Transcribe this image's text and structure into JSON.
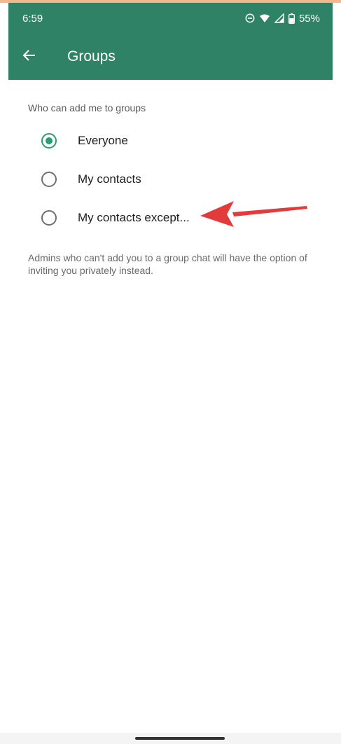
{
  "status_bar": {
    "time": "6:59",
    "battery": "55%",
    "icons": [
      "do-not-disturb-icon",
      "wifi-icon",
      "signal-icon",
      "battery-icon"
    ]
  },
  "app_bar": {
    "title": "Groups",
    "back_icon": "back-arrow-icon"
  },
  "settings": {
    "section_label": "Who can add me to groups",
    "options": [
      {
        "label": "Everyone",
        "selected": true
      },
      {
        "label": "My contacts",
        "selected": false
      },
      {
        "label": "My contacts except...",
        "selected": false
      }
    ],
    "note": "Admins who can't add you to a group chat will have the option of inviting you privately instead."
  },
  "colors": {
    "header": "#2f8265",
    "accent": "#2c9b75",
    "annotation_arrow": "#e23b3b"
  }
}
